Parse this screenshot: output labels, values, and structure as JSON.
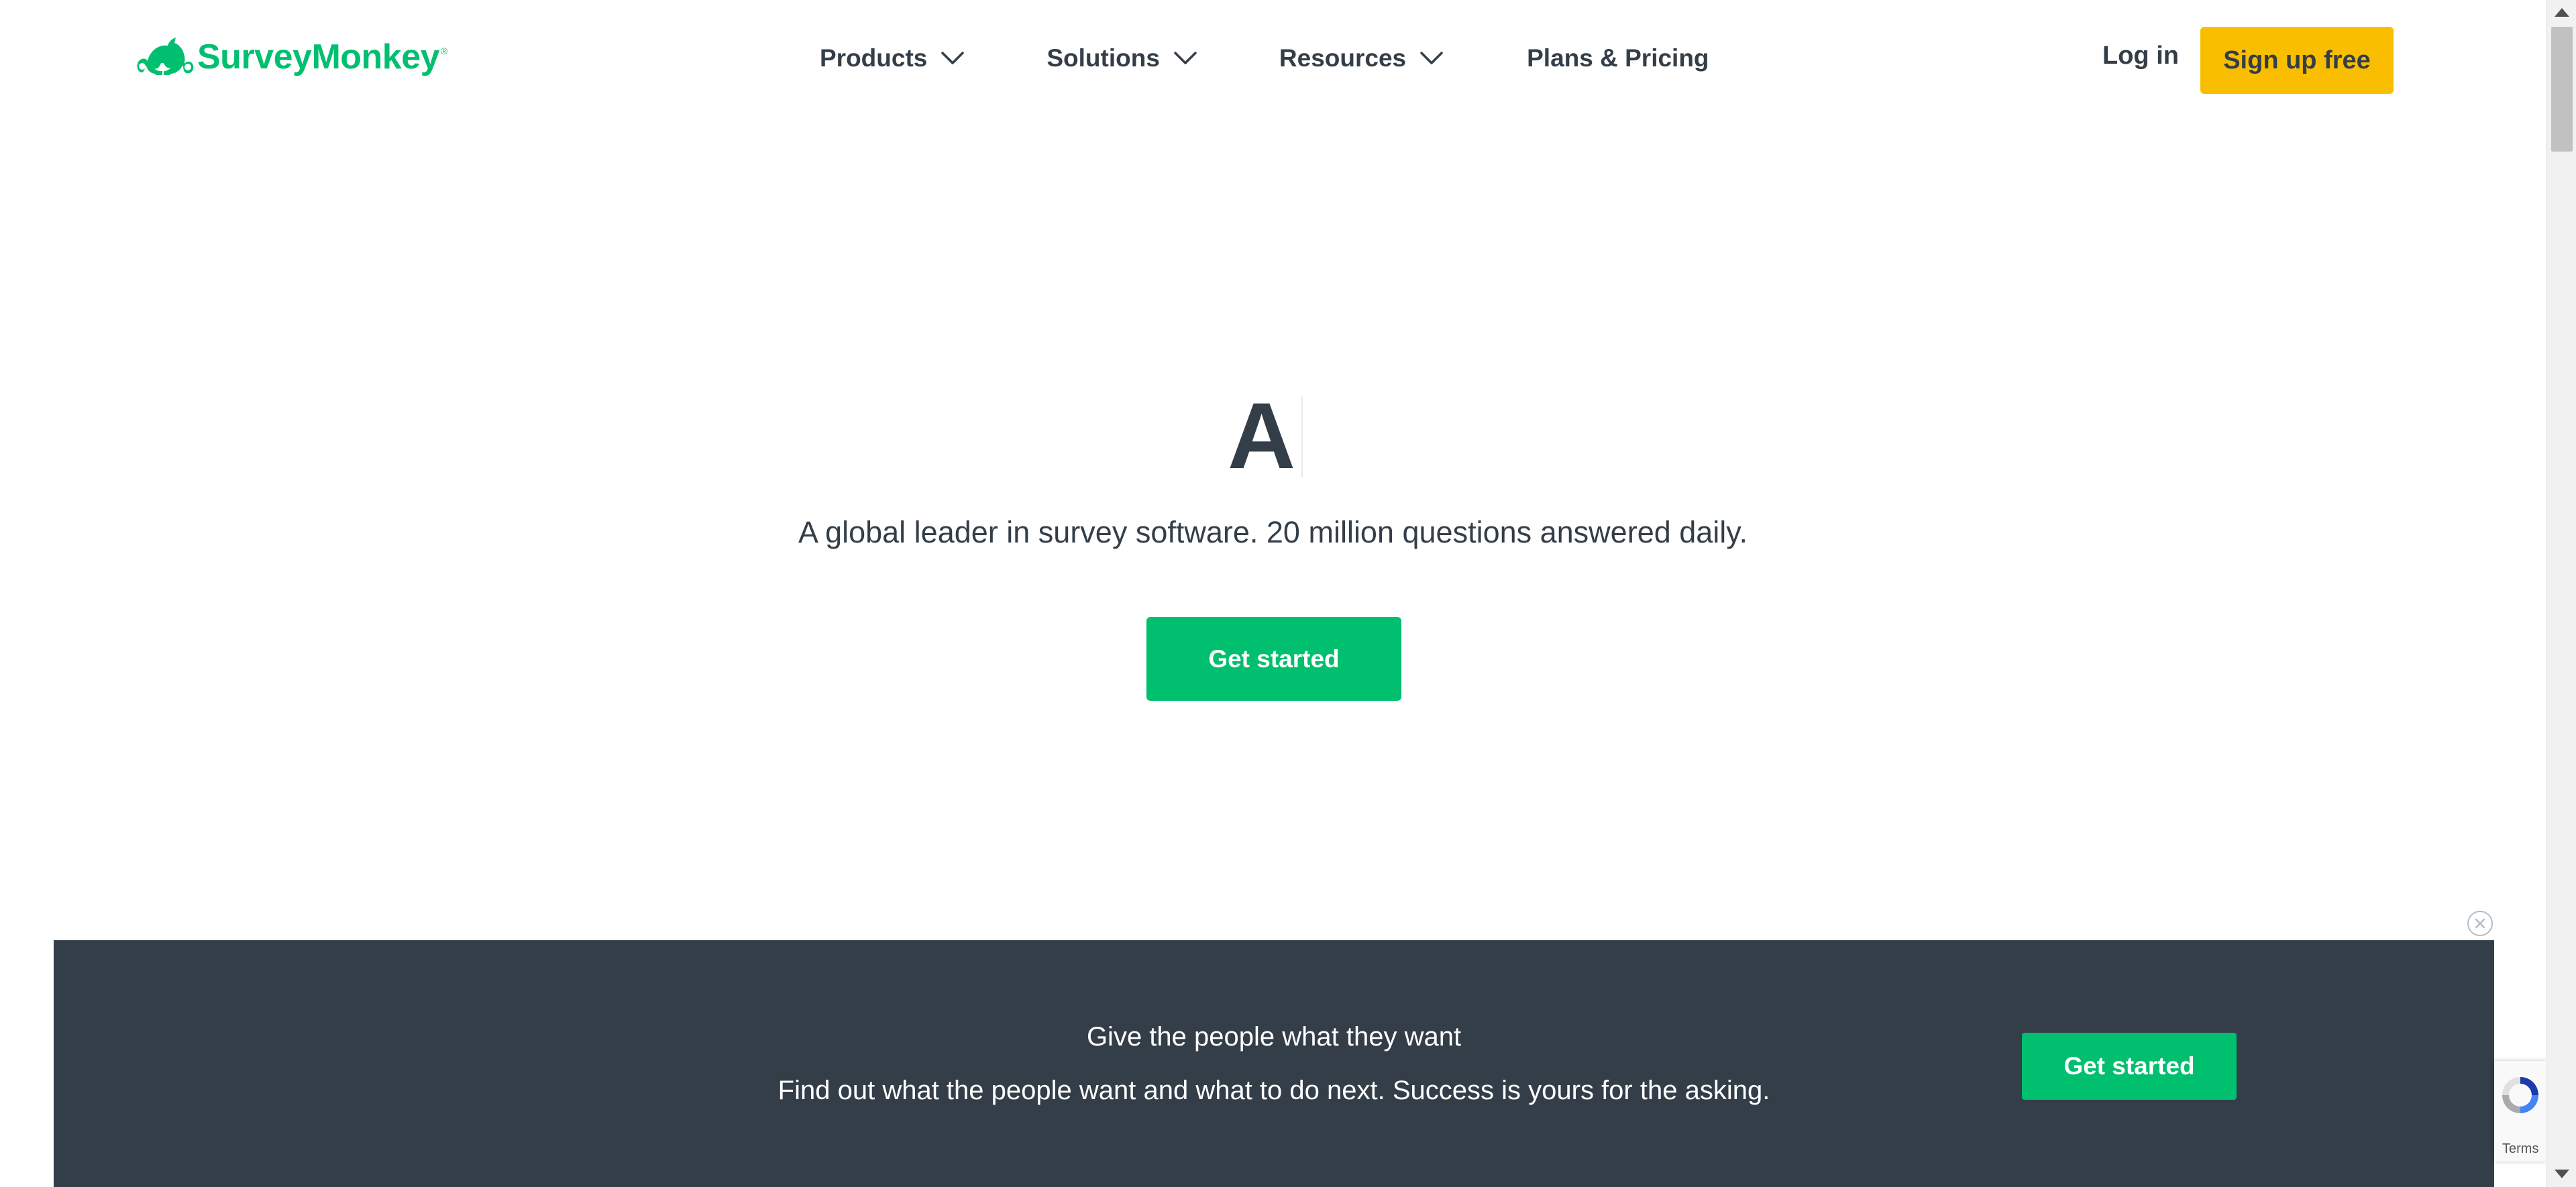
{
  "header": {
    "logo_text": "SurveyMonkey",
    "logo_mark": "®",
    "nav": [
      {
        "label": "Products",
        "icon": "chevron-down-icon"
      },
      {
        "label": "Solutions",
        "icon": "chevron-down-icon"
      },
      {
        "label": "Resources",
        "icon": "chevron-down-icon"
      },
      {
        "label": "Plans & Pricing"
      }
    ],
    "login_label": "Log in",
    "signup_label": "Sign up free"
  },
  "hero": {
    "typed_word": "A",
    "subtitle": "A global leader in survey software. 20 million questions answered daily.",
    "cta_label": "Get started"
  },
  "banner": {
    "title": "Give the people what they want",
    "text": "Find out what the people want and what to do next. Success is yours for the asking.",
    "cta_label": "Get started",
    "close_icon": "close-circle-icon"
  },
  "recaptcha": {
    "terms_label": "Terms"
  },
  "colors": {
    "brand_green": "#00bf6f",
    "signup_yellow": "#f9be00",
    "text_dark": "#333e48",
    "banner_bg": "#333e48"
  }
}
